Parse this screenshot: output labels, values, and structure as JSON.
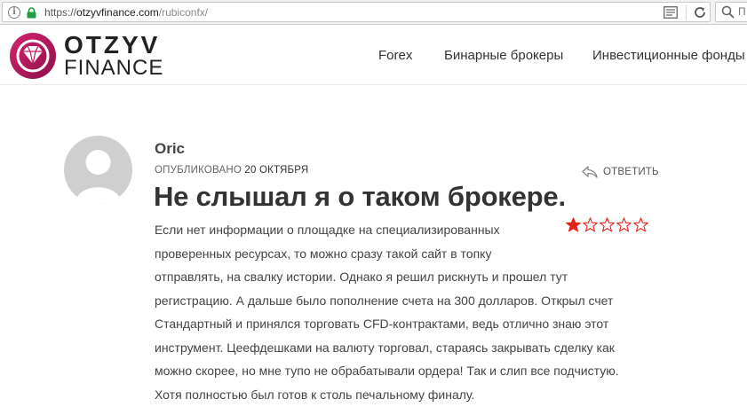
{
  "browser": {
    "url_scheme": "https://",
    "url_domain": "otzyvfinance.com",
    "url_path": "/rubiconfx/",
    "search_fragment": "П"
  },
  "site": {
    "logo_top": "OTZYV",
    "logo_bottom": "FINANCE",
    "brand_color": "#b5175f",
    "nav": [
      {
        "label": "Forex"
      },
      {
        "label": "Бинарные брокеры"
      },
      {
        "label": "Инвестиционные фонды"
      }
    ]
  },
  "comment": {
    "author": "Oric",
    "published_prefix": "ОПУБЛИКОВАНО",
    "published_date": "20 ОКТЯБРЯ",
    "reply_label": "ОТВЕТИТЬ",
    "title": "Не слышал я о таком брокере.",
    "rating": 1,
    "rating_max": 5,
    "star_color": "#e2231a",
    "body_lines": [
      "Если нет информации о площадке на специализированных",
      "проверенных ресурсах, то можно сразу такой сайт в топку",
      "отправлять, на свалку истории. Однако я решил рискнуть и прошел тут",
      "регистрацию. А дальше было пополнение счета на 300 долларов. Открыл счет",
      "Стандартный и принялся торговать CFD-контрактами, ведь отлично знаю этот",
      "инструмент. Цеефдешками на валюту торговал, стараясь закрывать сделку как",
      "можно скорее, но мне тупо не обрабатывали ордера! Так и слип все подчистую.",
      "Хотя полностью был готов к столь печальному финалу."
    ]
  }
}
